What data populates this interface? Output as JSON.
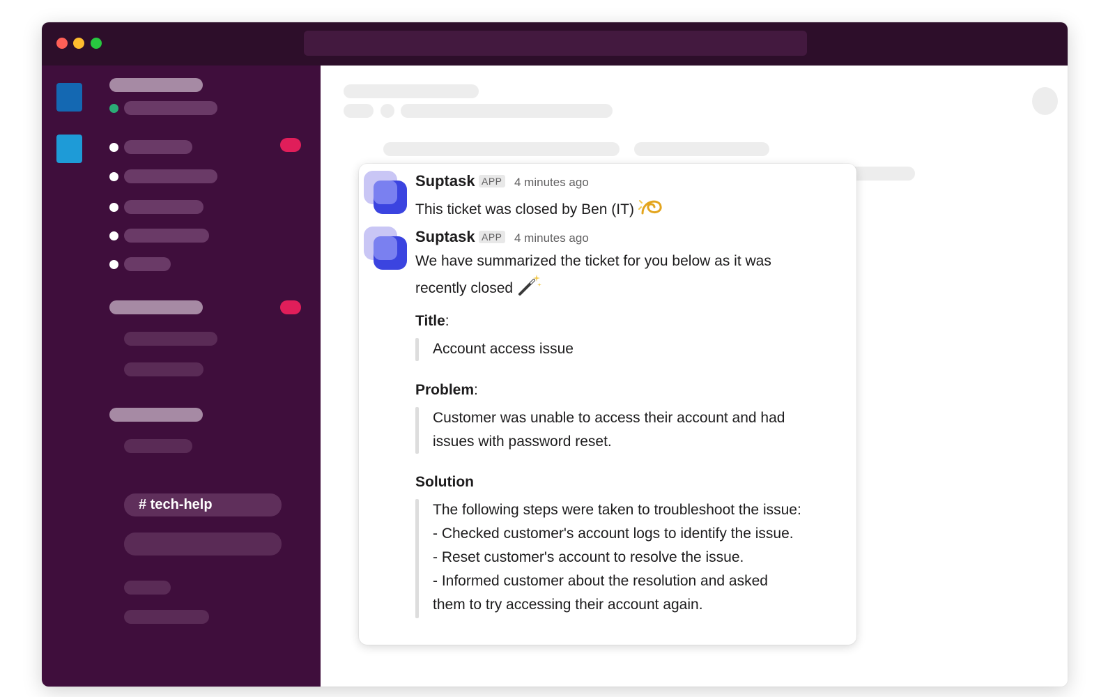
{
  "sidebar": {
    "active_channel": "# tech-help"
  },
  "messages": [
    {
      "author": "Suptask",
      "tag": "APP",
      "time": "4 minutes ago",
      "text": "This ticket was closed by Ben (IT)",
      "emoji": "dizzy-emoji"
    },
    {
      "author": "Suptask",
      "tag": "APP",
      "time": "4 minutes ago",
      "text_line1": "We have summarized the ticket for you below as it was",
      "text_line2": "recently closed",
      "emoji": "magic-wand-emoji"
    }
  ],
  "summary": {
    "title_label": "Title",
    "title_colon": ":",
    "title_value": "Account access issue",
    "problem_label": "Problem",
    "problem_colon": ":",
    "problem_line1": "Customer was unable to access their account and had",
    "problem_line2": "issues with password reset.",
    "solution_label": "Solution",
    "solution_lines": [
      "The following steps were taken to troubleshoot the issue:",
      "- Checked customer's account logs to identify the issue.",
      "- Reset customer's account to resolve the issue.",
      "- Informed customer about the resolution and asked",
      "them to try accessing their account again."
    ]
  },
  "colors": {
    "sidebar_bg": "#3f0e3c",
    "titlebar_bg": "#2d0e2a",
    "badge": "#e01e5a",
    "avatar_primary": "#3b44e0"
  }
}
